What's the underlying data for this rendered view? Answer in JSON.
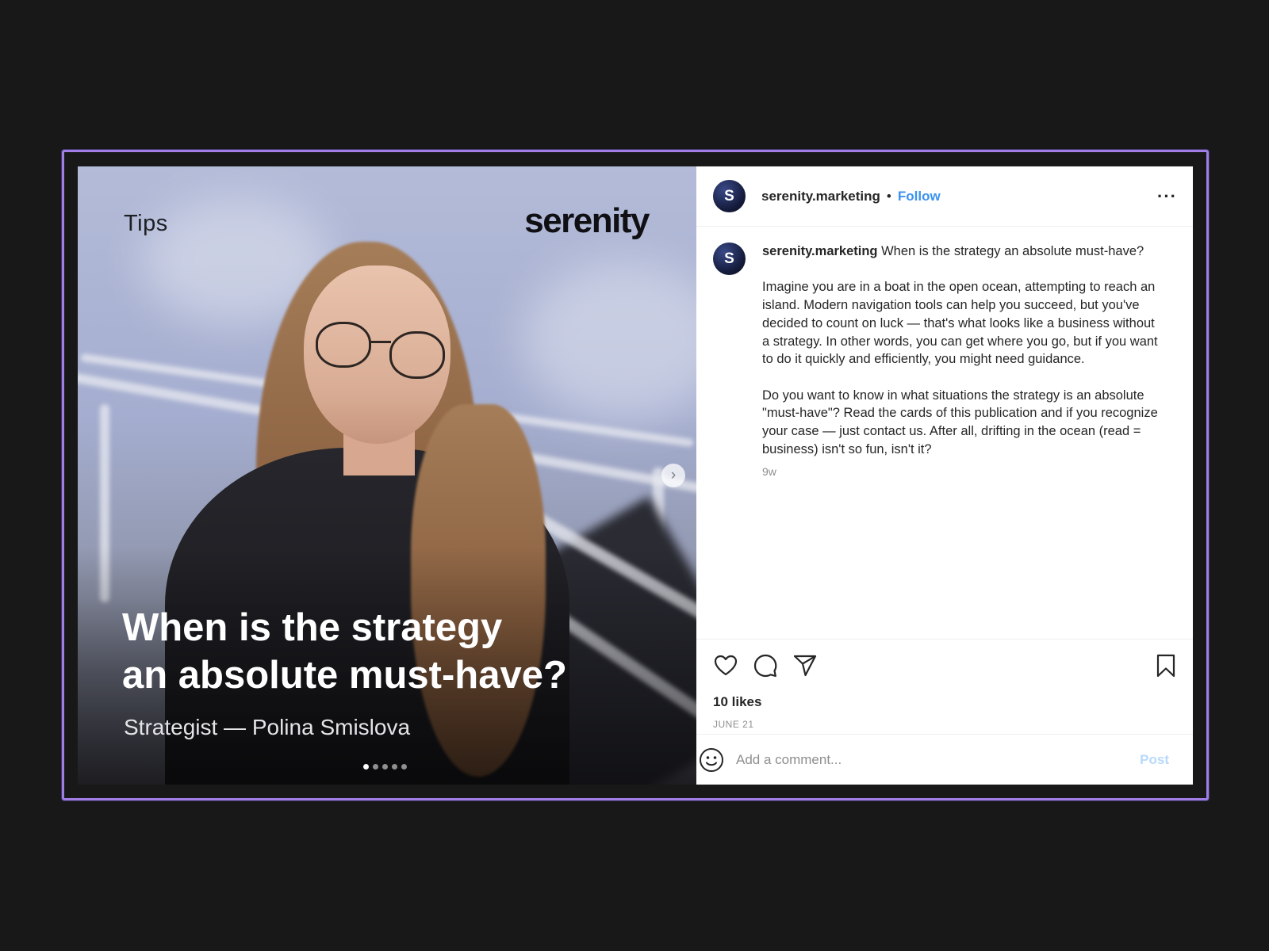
{
  "media": {
    "tag": "Tips",
    "brand": "serenity",
    "headline_line1": "When is the strategy",
    "headline_line2": "an absolute must-have?",
    "byline": "Strategist — Polina Smislova",
    "slide_count": 5,
    "active_slide": 1
  },
  "header": {
    "avatar_letter": "S",
    "username": "serenity.marketing",
    "separator": "•",
    "follow_label": "Follow",
    "more_label": "···"
  },
  "caption": {
    "avatar_letter": "S",
    "username": "serenity.marketing",
    "title": "When is the strategy an absolute must-have?",
    "paragraph1": "Imagine you are in a boat in the open ocean, attempting to reach an island. Modern navigation tools can help you succeed, but you've decided to count on luck — that's what looks like a business without a strategy. In other words, you can get where you go, but if you want to do it quickly and efficiently, you might need guidance.",
    "paragraph2": "Do you want to know in what situations the strategy is an absolute \"must-have\"? Read the cards of this publication and if you recognize your case — just contact us. After all, drifting in the ocean (read = business) isn't so fun, isn't it?",
    "age": "9w"
  },
  "actions": {
    "icons": [
      "heart-icon",
      "comment-icon",
      "share-icon",
      "bookmark-icon"
    ]
  },
  "likes": "10 likes",
  "date": "JUNE 21",
  "comment": {
    "placeholder": "Add a comment...",
    "post_label": "Post"
  },
  "colors": {
    "background": "#181818",
    "frame_border": "#a07ee6",
    "follow": "#3b93f1",
    "post_disabled": "#b8d9fb",
    "text": "#262626",
    "muted": "#8e8e8e"
  }
}
